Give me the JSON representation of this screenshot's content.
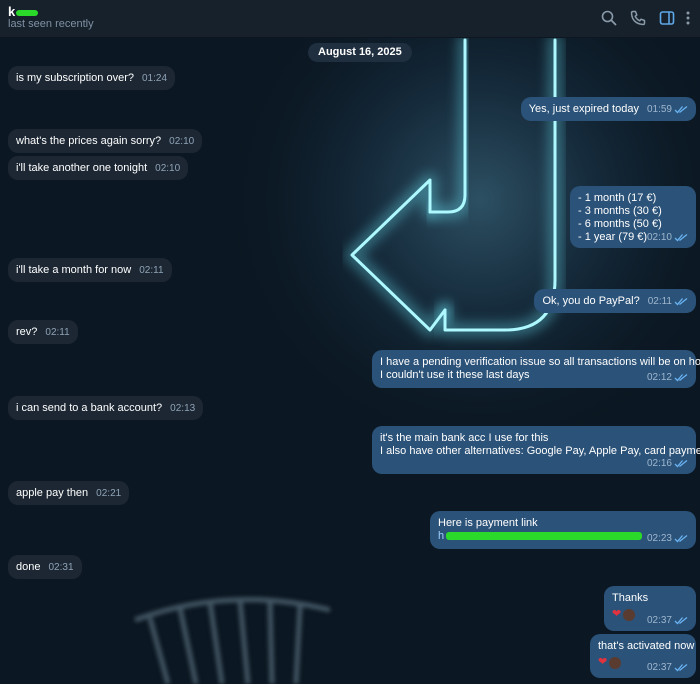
{
  "header": {
    "contact_name": "k",
    "status": "last seen recently",
    "icons": [
      "search-icon",
      "phone-icon",
      "sidebar-toggle-icon",
      "more-icon"
    ]
  },
  "chat": {
    "date": "August 16, 2025",
    "messages": [
      {
        "dir": "in",
        "lines": [
          "is my subscription over?"
        ],
        "time": "01:24"
      },
      {
        "dir": "out",
        "lines": [
          "Yes, just expired today"
        ],
        "time": "01:59"
      },
      {
        "dir": "in",
        "lines": [
          "what's the prices again sorry?"
        ],
        "time": "02:10"
      },
      {
        "dir": "in",
        "lines": [
          "i'll take another one tonight"
        ],
        "time": "02:10"
      },
      {
        "dir": "out",
        "lines": [
          "- 1 month (17 €)",
          "- 3 months (30 €)",
          "- 6 months (50 €)",
          "- 1 year (79 €)"
        ],
        "time": "02:10"
      },
      {
        "dir": "in",
        "lines": [
          "i'll take a month for now"
        ],
        "time": "02:11"
      },
      {
        "dir": "out",
        "lines": [
          "Ok, you do PayPal?"
        ],
        "time": "02:11"
      },
      {
        "dir": "in",
        "lines": [
          "rev?"
        ],
        "time": "02:11"
      },
      {
        "dir": "out",
        "lines": [
          "I have a pending verification issue so all transactions will be on hold,",
          "I couldn't use it these last days"
        ],
        "time": "02:12"
      },
      {
        "dir": "in",
        "lines": [
          "i can send to a bank account?"
        ],
        "time": "02:13"
      },
      {
        "dir": "out",
        "lines": [
          "it's the main bank acc I use for this",
          "I also have other alternatives: Google Pay, Apple Pay, card payment"
        ],
        "time": "02:16"
      },
      {
        "dir": "in",
        "lines": [
          "apple pay then"
        ],
        "time": "02:21"
      },
      {
        "dir": "out",
        "lines": [
          "Here is payment link",
          "h"
        ],
        "time": "02:23"
      },
      {
        "dir": "in",
        "lines": [
          "done"
        ],
        "time": "02:31"
      },
      {
        "dir": "out",
        "lines": [
          "Thanks"
        ],
        "time": "02:37",
        "reaction": "❤"
      },
      {
        "dir": "out",
        "lines": [
          "that's activated now"
        ],
        "time": "02:37",
        "reaction": "❤"
      }
    ]
  },
  "colors": {
    "header_bg": "#17212b",
    "incoming_bubble": "#1c2733",
    "outgoing_bubble": "#2b5278",
    "read_check": "#6ab3f3",
    "neon": "#7ff3ff"
  }
}
